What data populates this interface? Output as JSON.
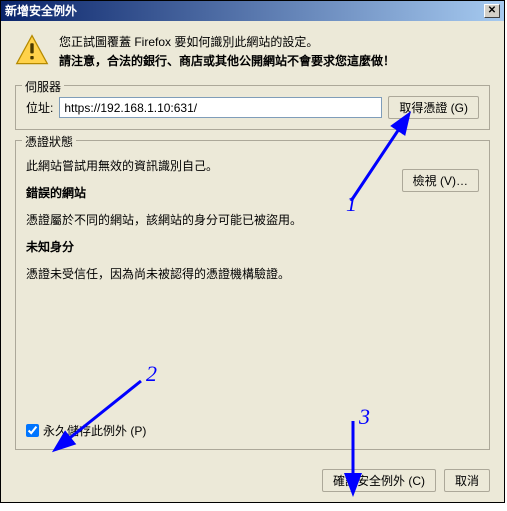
{
  "titlebar": {
    "title": "新增安全例外"
  },
  "warning": {
    "line1": "您正試圖覆蓋 Firefox 要如何識別此網站的設定。",
    "line2": "請注意，合法的銀行、商店或其他公開網站不會要求您這麼做！"
  },
  "server": {
    "legend": "伺服器",
    "location_label": "位址:",
    "url_value": "https://192.168.1.10:631/",
    "get_cert_label": "取得憑證 (G)"
  },
  "status": {
    "legend": "憑證狀態",
    "line_invalid": "此網站嘗試用無效的資訊識別自己。",
    "view_label": "檢視 (V)…",
    "wrong_site_heading": "錯誤的網站",
    "wrong_site_line": "憑證屬於不同的網站，該網站的身分可能已被盜用。",
    "unknown_heading": "未知身分",
    "unknown_line": "憑證未受信任，因為尚未被認得的憑證機構驗證。",
    "perm_label": "永久儲存此例外 (P)",
    "perm_checked": true
  },
  "footer": {
    "confirm_label": "確認安全例外 (C)",
    "cancel_label": "取消"
  },
  "annotations": {
    "n1": "1",
    "n2": "2",
    "n3": "3"
  }
}
